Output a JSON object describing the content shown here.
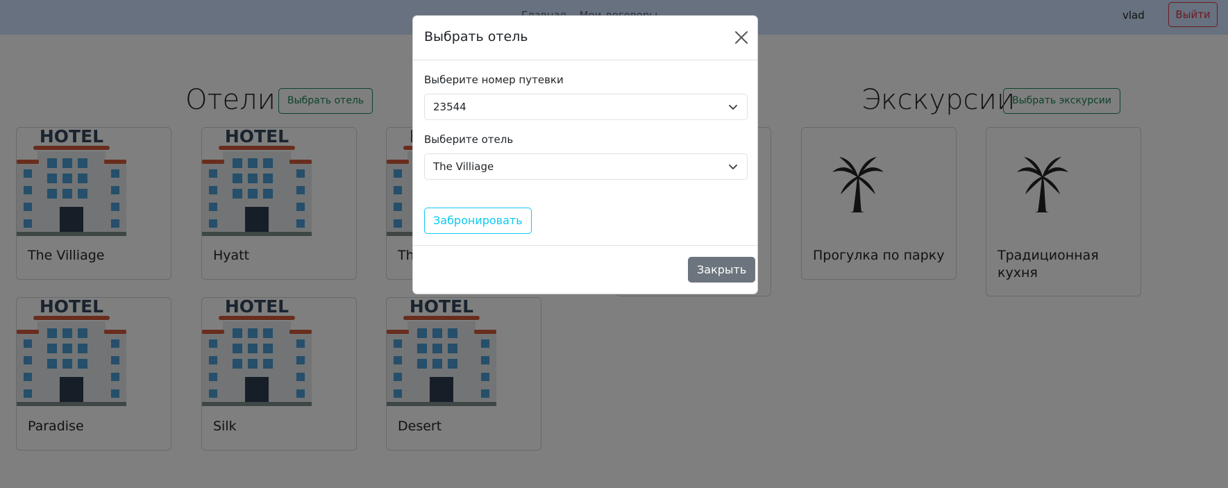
{
  "navbar": {
    "links": [
      "Главная",
      "Мои договоры"
    ],
    "user": "vlad",
    "logout_label": "Выйти"
  },
  "hotels": {
    "title": "Отели",
    "button_label": "Выбрать отель",
    "image_text": "HOTEL",
    "cards": [
      "The Villiage",
      "Hyatt",
      "Th",
      "Paradise",
      "Silk",
      "Desert"
    ]
  },
  "excursions": {
    "title": "Экскурсии",
    "button_label": "Выбрать экскурсии",
    "cards": [
      "Прогулка по парку",
      "Традиционная кухня"
    ]
  },
  "modal": {
    "title": "Выбрать отель",
    "voucher_label": "Выберите номер путевки",
    "voucher_value": "23544",
    "hotel_label": "Выберите отель",
    "hotel_value": "The Villiage",
    "book_label": "Забронировать",
    "close_label": "Закрыть"
  },
  "colors": {
    "navbar_bg": "#cfe2ff",
    "success": "#198754",
    "danger": "#dc3545",
    "info": "#0dcaf0",
    "secondary": "#6c757d"
  },
  "icons": [
    "hotel-building-icon",
    "palm-tree-icon",
    "close-icon",
    "chevron-down-icon"
  ]
}
